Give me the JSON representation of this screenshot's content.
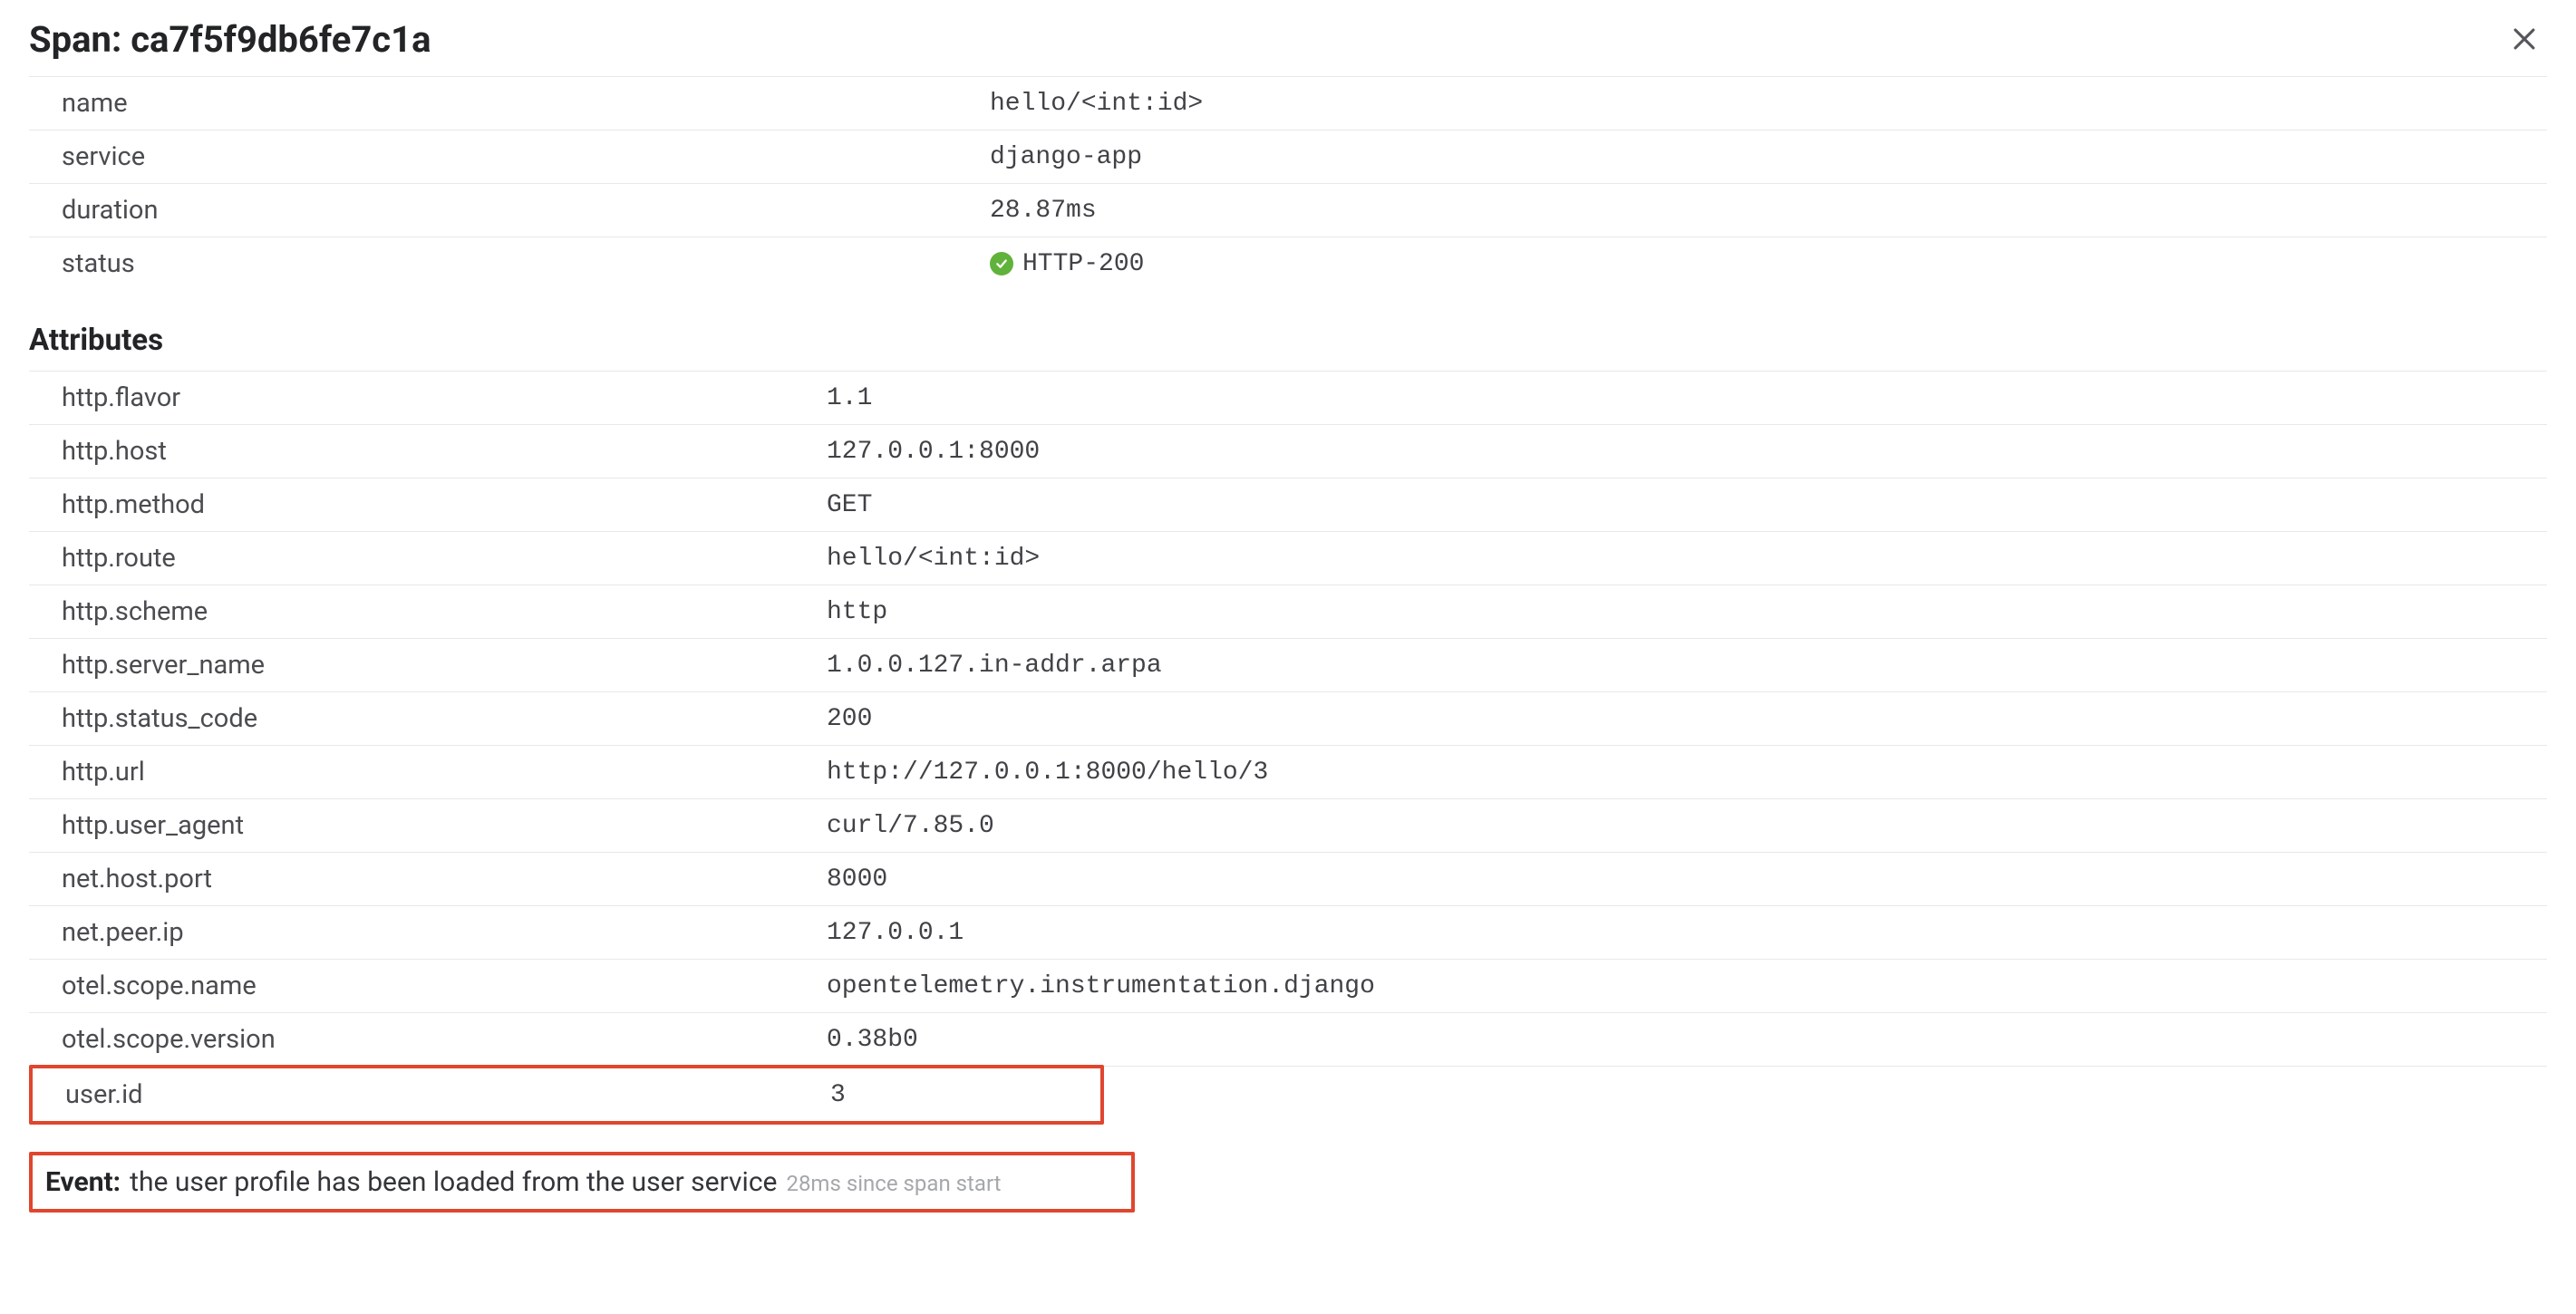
{
  "header": {
    "title_prefix": "Span:",
    "span_id": "ca7f5f9db6fe7c1a"
  },
  "overview": [
    {
      "key": "name",
      "value": "hello/<int:id>"
    },
    {
      "key": "service",
      "value": "django-app"
    },
    {
      "key": "duration",
      "value": "28.87ms"
    },
    {
      "key": "status",
      "value": "HTTP-200",
      "status_ok": true
    }
  ],
  "attributes_heading": "Attributes",
  "attributes": [
    {
      "key": "http.flavor",
      "value": "1.1"
    },
    {
      "key": "http.host",
      "value": "127.0.0.1:8000"
    },
    {
      "key": "http.method",
      "value": "GET"
    },
    {
      "key": "http.route",
      "value": "hello/<int:id>"
    },
    {
      "key": "http.scheme",
      "value": "http"
    },
    {
      "key": "http.server_name",
      "value": "1.0.0.127.in-addr.arpa"
    },
    {
      "key": "http.status_code",
      "value": "200"
    },
    {
      "key": "http.url",
      "value": "http://127.0.0.1:8000/hello/3"
    },
    {
      "key": "http.user_agent",
      "value": "curl/7.85.0"
    },
    {
      "key": "net.host.port",
      "value": "8000"
    },
    {
      "key": "net.peer.ip",
      "value": "127.0.0.1"
    },
    {
      "key": "otel.scope.name",
      "value": "opentelemetry.instrumentation.django"
    },
    {
      "key": "otel.scope.version",
      "value": "0.38b0"
    }
  ],
  "highlighted_attribute": {
    "key": "user.id",
    "value": "3"
  },
  "event": {
    "label": "Event:",
    "description": "the user profile has been loaded from the user service",
    "timestamp_note": "28ms since span start"
  }
}
